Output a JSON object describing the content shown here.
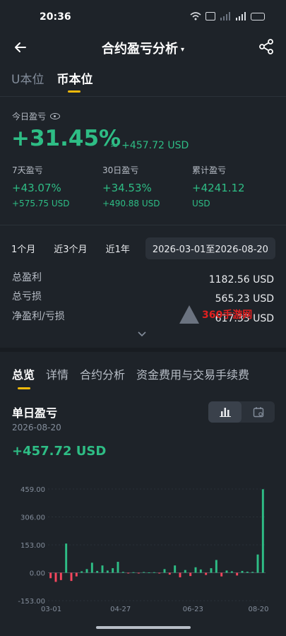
{
  "status_bar": {
    "time": "20:36"
  },
  "nav": {
    "title": "合约盈亏分析",
    "caret": "▾"
  },
  "unit_tabs": [
    {
      "label": "U本位",
      "active": false
    },
    {
      "label": "币本位",
      "active": true
    }
  ],
  "today": {
    "label": "今日盈亏",
    "pct": "+31.45%",
    "usd": "≈ +457.72 USD"
  },
  "stats": [
    {
      "label": "7天盈亏",
      "pct": "+43.07%",
      "usd": "+575.75 USD"
    },
    {
      "label": "30日盈亏",
      "pct": "+34.53%",
      "usd": "+490.88 USD"
    },
    {
      "label": "累计盈亏",
      "pct": "+4241.12",
      "usd": "USD"
    }
  ],
  "range": {
    "options": [
      "1个月",
      "近3个月",
      "近1年"
    ],
    "date_range": "2026-03-01至2026-08-20"
  },
  "summary": [
    {
      "label": "总盈利",
      "value": "1182.56 USD"
    },
    {
      "label": "总亏损",
      "value": "565.23 USD"
    },
    {
      "label": "净盈利/亏损",
      "value": "617.33 USD"
    }
  ],
  "watermark": {
    "text": "360手游网"
  },
  "section_tabs": [
    {
      "label": "总览",
      "active": true
    },
    {
      "label": "详情",
      "active": false
    },
    {
      "label": "合约分析",
      "active": false
    },
    {
      "label": "资金费用与交易手续费",
      "active": false
    }
  ],
  "daily": {
    "title": "单日盈亏",
    "date": "2026-08-20",
    "value": "+457.72 USD"
  },
  "colors": {
    "positive": "#2ebd85",
    "negative": "#f6465d",
    "accent": "#f0b90b"
  },
  "chart_data": {
    "type": "bar",
    "y_ticks": [
      "459.00",
      "306.00",
      "153.00",
      "0.00",
      "-153.00"
    ],
    "x_ticks": [
      "03-01",
      "04-27",
      "06-23",
      "08-20"
    ],
    "ylim": [
      -153,
      459
    ],
    "values": [
      -30,
      -50,
      -40,
      160,
      -45,
      -20,
      8,
      20,
      55,
      10,
      40,
      12,
      25,
      60,
      5,
      -3,
      3,
      -2,
      4,
      2,
      3,
      -4,
      20,
      -10,
      40,
      -25,
      15,
      -18,
      30,
      18,
      -12,
      25,
      70,
      -20,
      12,
      8,
      -15,
      10,
      6,
      5,
      100,
      457.72
    ]
  }
}
